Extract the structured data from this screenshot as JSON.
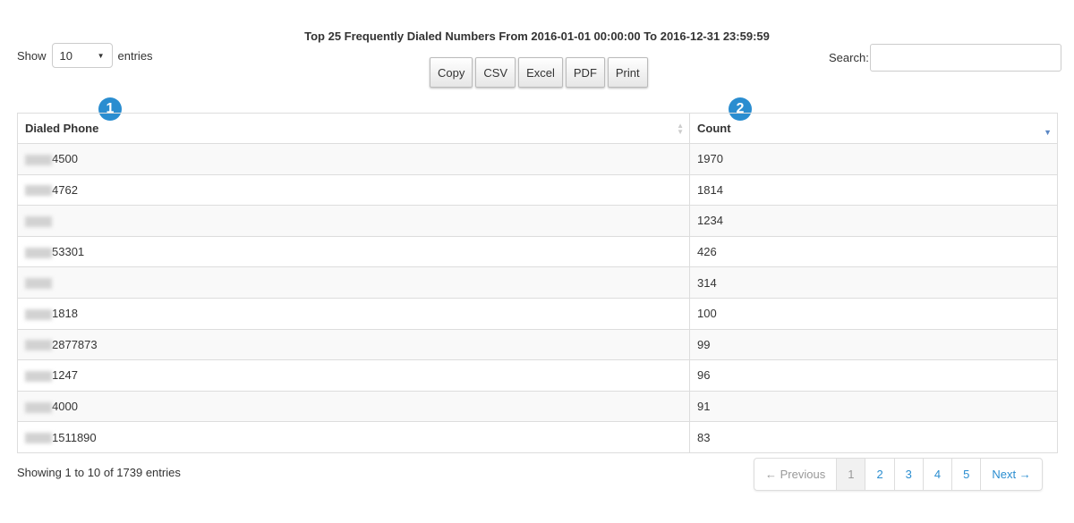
{
  "title": "Top 25 Frequently Dialed Numbers From 2016-01-01 00:00:00 To 2016-12-31 23:59:59",
  "length": {
    "show": "Show",
    "value": "10",
    "entries": "entries"
  },
  "buttons": [
    "Copy",
    "CSV",
    "Excel",
    "PDF",
    "Print"
  ],
  "search": {
    "label": "Search:",
    "value": ""
  },
  "badges": [
    "1",
    "2"
  ],
  "columns": [
    "Dialed Phone",
    "Count"
  ],
  "rows": [
    {
      "phone": "4500",
      "count": "1970"
    },
    {
      "phone": "4762",
      "count": "1814"
    },
    {
      "phone": "",
      "count": "1234"
    },
    {
      "phone": "53301",
      "count": "426"
    },
    {
      "phone": "",
      "count": "314"
    },
    {
      "phone": "1818",
      "count": "100"
    },
    {
      "phone": "2877873",
      "count": "99"
    },
    {
      "phone": "1247",
      "count": "96"
    },
    {
      "phone": "4000",
      "count": "91"
    },
    {
      "phone": "1511890",
      "count": "83"
    }
  ],
  "info": "Showing 1 to 10 of 1739 entries",
  "pagination": [
    "← Previous",
    "1",
    "2",
    "3",
    "4",
    "5",
    "Next →"
  ],
  "colors": {
    "accent": "#2a8dd0"
  }
}
